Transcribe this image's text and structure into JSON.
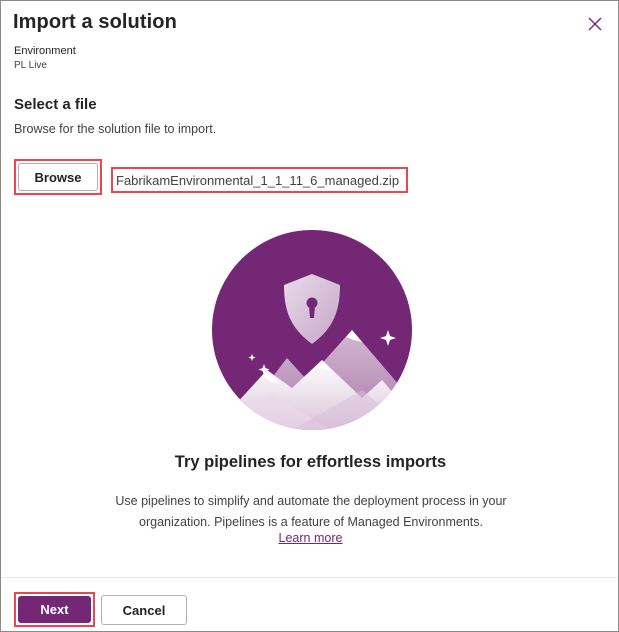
{
  "dialog": {
    "title": "Import a solution",
    "close_icon": "close-icon"
  },
  "environment": {
    "label": "Environment",
    "value": "PL Live"
  },
  "select_file": {
    "title": "Select a file",
    "description": "Browse for the solution file to import.",
    "browse_label": "Browse",
    "file_name": "FabrikamEnvironmental_1_1_11_6_managed.zip"
  },
  "illustration": {
    "icon": "shield-mountains-illustration",
    "colors": {
      "circle": "#742774",
      "shield": "#f0e6f0",
      "mountains": "#e9dbe9"
    }
  },
  "promo": {
    "title": "Try pipelines for effortless imports",
    "description": "Use pipelines to simplify and automate the deployment process in your organization. Pipelines is a feature of Managed Environments.",
    "learn_more": "Learn more"
  },
  "footer": {
    "next_label": "Next",
    "cancel_label": "Cancel"
  },
  "colors": {
    "accent": "#742774",
    "highlight_border": "#e8474e"
  }
}
